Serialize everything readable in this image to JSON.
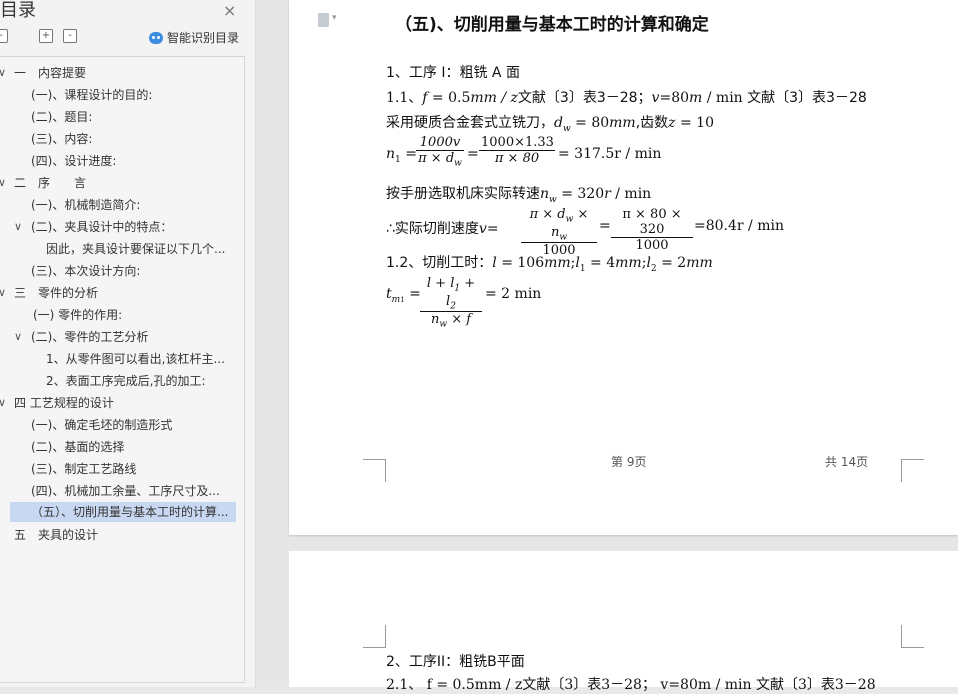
{
  "sidebar": {
    "title": "目录",
    "close": "×",
    "btn_collapse": "-",
    "btn_expand": "+",
    "btn_minus": "-",
    "smart": "智能识别目录",
    "toc": [
      {
        "label": "一　内容提要",
        "chev": "∨"
      },
      {
        "label": "(一)、课程设计的目的:"
      },
      {
        "label": "(二)、题目:"
      },
      {
        "label": "(三)、内容:"
      },
      {
        "label": "(四)、设计进度:"
      },
      {
        "label": "二　序　　言",
        "chev": "∨"
      },
      {
        "label": "(一)、机械制造简介:"
      },
      {
        "label": "(二)、夹具设计中的特点：",
        "chev": "∨"
      },
      {
        "label": "因此，夹具设计要保证以下几个..."
      },
      {
        "label": "(三)、本次设计方向:"
      },
      {
        "label": "三　零件的分析",
        "chev": "∨"
      },
      {
        "label": "(一) 零件的作用:"
      },
      {
        "label": "(二)、零件的工艺分析",
        "chev": "∨"
      },
      {
        "label": "1、从零件图可以看出,该杠杆主..."
      },
      {
        "label": "2、表面工序完成后,孔的加工:"
      },
      {
        "label": "四  工艺规程的设计",
        "chev": "∨"
      },
      {
        "label": "(一)、确定毛坯的制造形式"
      },
      {
        "label": "(二)、基面的选择"
      },
      {
        "label": "(三)、制定工艺路线"
      },
      {
        "label": "(四)、机械加工余量、工序尺寸及..."
      },
      {
        "label": "（五）、切削用量与基本工时的计算..."
      },
      {
        "label": "五　夹具的设计"
      }
    ]
  },
  "doc": {
    "heading": "（五)、切削用量与基本工时的计算和确定",
    "l1": "1、工序 I：粗铣 A 面",
    "l2a": "1.1、",
    "l2b": "f",
    "l2c": " = 0.5",
    "l2d": "mm / z",
    "l2e": "文献〔3〕表3－28；",
    "l2f": "v",
    "l2g": "=80",
    "l2h": "m",
    "l2i": " / min",
    "l2j": " 文献〔3〕表3－28",
    "l3a": "采用硬质合金套式立铣刀，",
    "l3b": "d",
    "l3c": "w",
    "l3d": " = 80",
    "l3e": "mm",
    "l3f": ",齿数",
    "l3g": "z",
    "l3h": " = 10",
    "f1_lhs": "n",
    "f1_sub": "1",
    "f1_eq": "=",
    "f1_n1": "1000v",
    "f1_d1": "π × d",
    "f1_d1s": "w",
    "f1_eq2": "=",
    "f1_n2": "1000×1.33",
    "f1_d2": "π × 80",
    "f1_res": "= 317.5r / min",
    "l5a": "按手册选取机床实际转速",
    "l5b": "n",
    "l5c": "w",
    "l5d": " = 320",
    "l5e": "r",
    "l5f": " / min",
    "f2_pre": "∴实际切削速度",
    "f2_v": "v",
    "f2_eq": "=",
    "f2_n1": "π × d",
    "f2_n1s": "w",
    "f2_n1b": " × n",
    "f2_n1bs": "w",
    "f2_d1": "1000",
    "f2_eq2": "=",
    "f2_n2": "π × 80 × 320",
    "f2_d2": "1000",
    "f2_res": "=80.4r / min",
    "l7a": "1.2、切削工时：",
    "l7b": "l",
    "l7c": " = 106",
    "l7d": "mm",
    "l7e": ";",
    "l7f": "l",
    "l7g": "1",
    "l7h": " = 4",
    "l7i": "mm",
    "l7j": ";",
    "l7k": "l",
    "l7l": "2",
    "l7m": " = 2",
    "l7n": "mm",
    "f3_t": "t",
    "f3_ts": "m",
    "f3_tss": "1",
    "f3_eq": "=",
    "f3_num": "l + l",
    "f3_num1": "1",
    "f3_num2": " + l",
    "f3_num3": "2",
    "f3_den": "n",
    "f3_dens": "w",
    "f3_den2": " × f",
    "f3_res": "= 2 min",
    "page_no": "第 9页",
    "page_total": "共 14页",
    "p2_l1": "2、工序II：粗铣B平面",
    "p2_l2": "2.1、 f = 0.5mm / z文献〔3〕表3－28；  v=80m / min  文献〔3〕表3－28"
  }
}
